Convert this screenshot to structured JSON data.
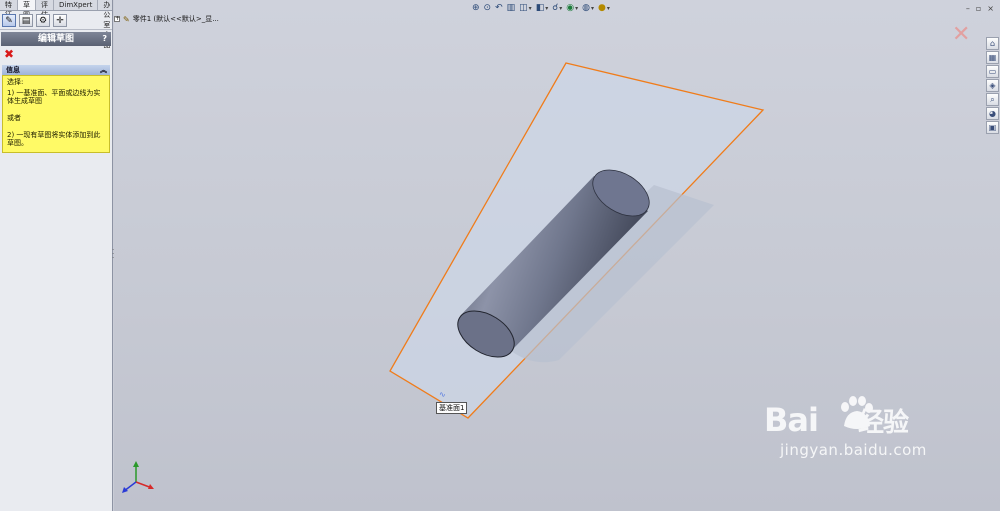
{
  "tabs": [
    "特征",
    "草图",
    "评估",
    "DimXpert",
    "办公室产品"
  ],
  "active_tab": 1,
  "property_manager": {
    "title": "编辑草图",
    "help_label": "?",
    "tool_icons": [
      "sketch-icon",
      "document-icon",
      "feature-manager-icon",
      "crosshair-icon"
    ],
    "message_title": "信息",
    "message_lines": [
      "选择:",
      "1) 一基准面、平面或边线为实体生成草图",
      "",
      "或者",
      "",
      "2) 一现有草图将实体添加到此草图。"
    ]
  },
  "tree": {
    "label": "零件1 (默认<<默认>_显..."
  },
  "view_toolbar_icons": [
    "zoom-to-fit-icon",
    "zoom-to-area-icon",
    "previous-view-icon",
    "section-view-icon",
    "view-orientation-icon",
    "display-style-icon",
    "hide-show-items-icon",
    "edit-appearance-icon",
    "apply-scene-icon"
  ],
  "window_controls": [
    "–",
    "▫",
    "×"
  ],
  "tooltip": "基准面1",
  "watermark": {
    "brand": "Bai",
    "brand_suffix": "经验",
    "url": "jingyan.baidu.com"
  },
  "colors": {
    "plane_edge": "#f07c1a",
    "plane_fill": "#ccd6e6",
    "cylinder": "#6c7288",
    "panel_bg": "#e9ebf0",
    "info_bg": "#fffa66",
    "viewport_bg": "#c9ccd6"
  }
}
